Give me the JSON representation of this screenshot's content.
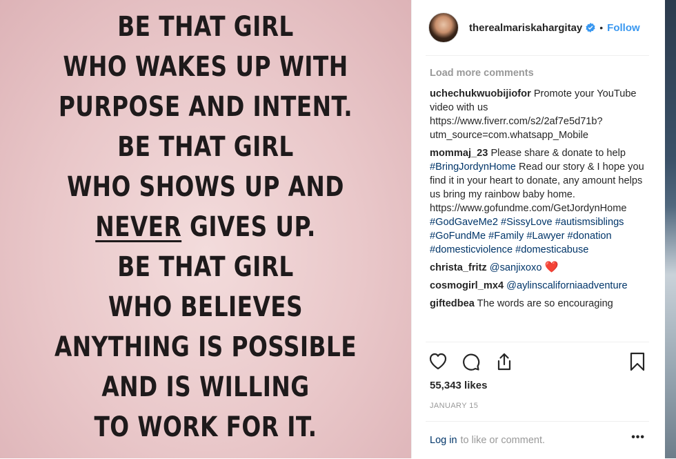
{
  "image": {
    "quote_lines": [
      "BE THAT GIRL",
      "WHO WAKES UP WITH",
      "PURPOSE AND INTENT.",
      "BE THAT GIRL",
      "WHO SHOWS UP AND",
      "NEVER",
      "GIVES UP.",
      "BE THAT GIRL",
      "WHO BELIEVES",
      "ANYTHING IS POSSIBLE",
      "AND IS WILLING",
      "TO WORK FOR IT."
    ]
  },
  "header": {
    "username": "therealmariskahargitay",
    "separator": "•",
    "follow_label": "Follow",
    "verified_icon": "verified-badge-icon",
    "accent": "#3897f0"
  },
  "comments": {
    "load_more": "Load more comments",
    "items": [
      {
        "user": "uchechukwuobijiofor",
        "text": "Promote your YouTube video with us https://www.fiverr.com/s2/2af7e5d71b?utm_source=com.whatsapp_Mobile"
      },
      {
        "user": "mommaj_23",
        "text_1": "Please share & donate to help",
        "tag_1": "#BringJordynHome",
        "text_2": "Read our story & I hope you find it in your heart to donate, any amount helps us bring my rainbow baby home. https://www.gofundme.com/GetJordynHome",
        "tags": "#GodGaveMe2 #SissyLove #autismsiblings #GoFundMe #Family #Lawyer #donation #domesticviolence #domesticabuse"
      },
      {
        "user": "christa_fritz",
        "mention": "@sanjixoxo",
        "emoji": "❤️"
      },
      {
        "user": "cosmogirl_mx4",
        "mention": "@aylinscaliforniaadventure"
      },
      {
        "user": "giftedbea",
        "text": "The words are so encouraging"
      }
    ]
  },
  "actions": {
    "like_icon": "heart-icon",
    "comment_icon": "comment-icon",
    "share_icon": "share-icon",
    "save_icon": "bookmark-icon"
  },
  "likes": "55,343 likes",
  "date": "JANUARY 15",
  "footer": {
    "login_label": "Log in",
    "rest": "to like or comment.",
    "more": "•••"
  }
}
